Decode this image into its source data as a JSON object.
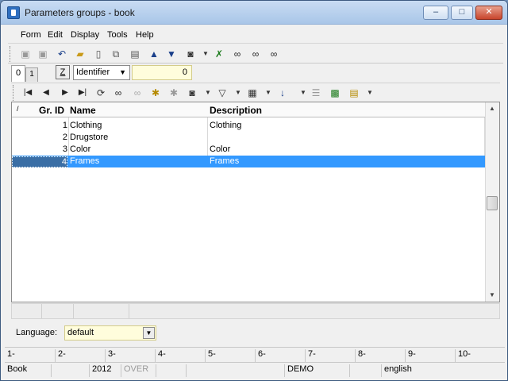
{
  "window": {
    "title": "Parameters groups - book",
    "controls": {
      "minimize": "–",
      "maximize": "□",
      "close": "✕"
    }
  },
  "menu": [
    "Form",
    "Edit",
    "Display",
    "Tools",
    "Help"
  ],
  "toolbar1_icons": [
    "save-icon",
    "save-as-icon",
    "undo-icon",
    "open-folder-icon",
    "new-document-icon",
    "copy-icon",
    "book-icon",
    "arrow-up-icon",
    "arrow-down-icon",
    "camera-icon",
    "dropdown-icon",
    "x-binoculars-icon",
    "binoculars-icon",
    "binoculars-next-icon",
    "binoculars-prev-icon"
  ],
  "tabs": {
    "tab0": "0",
    "tab1": "1"
  },
  "filter": {
    "z_label": "Z",
    "sort_combo": "Identifier",
    "value": "0"
  },
  "grid": {
    "headers": {
      "id": "Gr. ID",
      "name": "Name",
      "description": "Description"
    },
    "sort_indicator": "/",
    "rows": [
      {
        "id": "1",
        "name": "Clothing",
        "description": "Clothing"
      },
      {
        "id": "2",
        "name": "Drugstore",
        "description": ""
      },
      {
        "id": "3",
        "name": "Color",
        "description": "Color"
      },
      {
        "id": "4",
        "name": "Frames",
        "description": "Frames"
      }
    ],
    "selected_row": 3
  },
  "language": {
    "label": "Language:",
    "value": "default"
  },
  "fkeys": [
    "1-",
    "2-",
    "3-",
    "4-",
    "5-",
    "6-",
    "7-",
    "8-",
    "9-",
    "10-"
  ],
  "status": {
    "module": "Book",
    "year": "2012",
    "mode": "OVER",
    "db": "DEMO",
    "lang": "english"
  },
  "colors": {
    "selection": "#3399ff",
    "yellow_field": "#fffddc"
  }
}
